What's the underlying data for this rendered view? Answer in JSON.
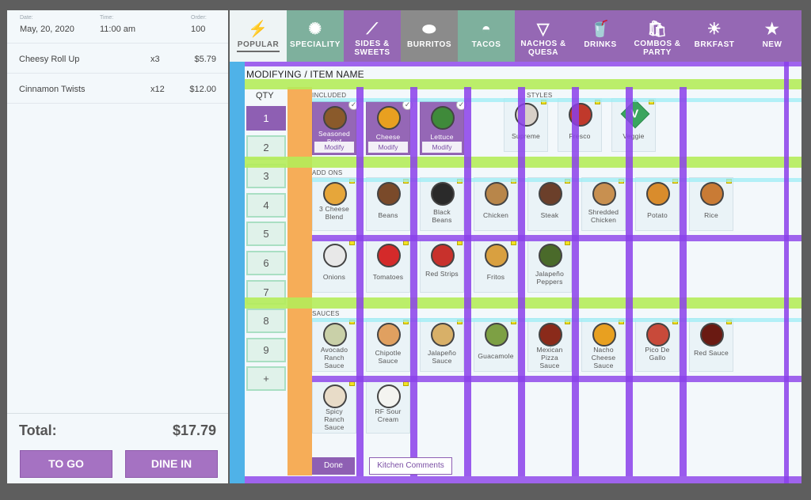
{
  "order": {
    "date_label": "Date:",
    "date_value": "May, 20, 2020",
    "time_label": "Time:",
    "time_value": "11:00 am",
    "order_label": "Order:",
    "order_value": "100",
    "items": [
      {
        "name": "Cheesy Roll Up",
        "qty": "x3",
        "price": "$5.79"
      },
      {
        "name": "Cinnamon Twists",
        "qty": "x12",
        "price": "$12.00"
      }
    ],
    "total_label": "Total:",
    "total_value": "$17.79",
    "to_go_label": "TO GO",
    "dine_in_label": "DINE IN"
  },
  "categories": [
    {
      "label": "POPULAR",
      "icon": "lightning-icon",
      "glyph": "⚡"
    },
    {
      "label": "SPECIALITY",
      "icon": "star-badge-icon",
      "glyph": "✺"
    },
    {
      "label": "SIDES & SWEETS",
      "icon": "churro-icon",
      "glyph": "⟋"
    },
    {
      "label": "BURRITOS",
      "icon": "burrito-icon",
      "glyph": "⬬"
    },
    {
      "label": "TACOS",
      "icon": "taco-icon",
      "glyph": "◓"
    },
    {
      "label": "NACHOS & QUESA",
      "icon": "nachos-icon",
      "glyph": "▽"
    },
    {
      "label": "DRINKS",
      "icon": "drink-cup-icon",
      "glyph": "🥤"
    },
    {
      "label": "COMBOS & PARTY",
      "icon": "combo-bag-icon",
      "glyph": "🛍"
    },
    {
      "label": "BRKFAST",
      "icon": "sunrise-icon",
      "glyph": "☀"
    },
    {
      "label": "NEW",
      "icon": "star-icon",
      "glyph": "★"
    }
  ],
  "colors": {
    "tab_popular": "#eef4f5",
    "tab_speciality": "#7eb09d",
    "tab_sides": "#9568b4",
    "tab_burritos": "#8b8b8b",
    "tab_tacos": "#7eb09d",
    "tab_nachos": "#9568b4",
    "tab_drinks": "#9568b4",
    "tab_combos": "#9568b4",
    "tab_brkfast": "#9568b4",
    "tab_new": "#9568b4"
  },
  "modifier": {
    "title": "MODIFYING / ITEM NAME",
    "qty_label": "QTY",
    "qty_options": [
      "1",
      "2",
      "3",
      "4",
      "5",
      "6",
      "7",
      "8",
      "9",
      "+"
    ],
    "selected_qty": "1",
    "included_title": "INCLUDED",
    "included": [
      {
        "name": "Seasoned Beef",
        "modify": "Modify",
        "color": "#8a5a2b"
      },
      {
        "name": "Cheese",
        "modify": "Modify",
        "color": "#e8a020"
      },
      {
        "name": "Lettuce",
        "modify": "Modify",
        "color": "#3f8a3a"
      }
    ],
    "styles_title": "STYLES",
    "styles": [
      {
        "name": "Supreme",
        "color": "#d8d0c8"
      },
      {
        "name": "Fresco",
        "color": "#c0392b"
      },
      {
        "name": "Veggie",
        "badge": "V"
      }
    ],
    "addons_title": "ADD ONS",
    "addons": [
      {
        "name": "3 Cheese Blend",
        "color": "#e6a63a"
      },
      {
        "name": "Beans",
        "color": "#7a4a2a"
      },
      {
        "name": "Black Beans",
        "color": "#2a2a2a"
      },
      {
        "name": "Chicken",
        "color": "#b8864a"
      },
      {
        "name": "Steak",
        "color": "#6b3f2a"
      },
      {
        "name": "Shredded Chicken",
        "color": "#c89050"
      },
      {
        "name": "Potato",
        "color": "#d98c2c"
      },
      {
        "name": "Rice",
        "color": "#c97b35"
      },
      {
        "name": "Onions",
        "color": "#e8e8e8"
      },
      {
        "name": "Tomatoes",
        "color": "#d42a2a"
      },
      {
        "name": "Red Strips",
        "color": "#c8312c"
      },
      {
        "name": "Fritos",
        "color": "#d9a040"
      },
      {
        "name": "Jalapeño Peppers",
        "color": "#4a6a2a"
      }
    ],
    "sauces_title": "SAUCES",
    "sauces": [
      {
        "name": "Avocado Ranch Sauce",
        "color": "#c9d0a8"
      },
      {
        "name": "Chipotle Sauce",
        "color": "#e0a060"
      },
      {
        "name": "Jalapeño Sauce",
        "color": "#d8b068"
      },
      {
        "name": "Guacamole",
        "color": "#7da044"
      },
      {
        "name": "Mexican Pizza Sauce",
        "color": "#8a2a1a"
      },
      {
        "name": "Nacho Cheese Sauce",
        "color": "#e8a020"
      },
      {
        "name": "Pico De Gallo",
        "color": "#c84a3a"
      },
      {
        "name": "Red Sauce",
        "color": "#6a1a12"
      },
      {
        "name": "Spicy Ranch Sauce",
        "color": "#e8dcc8"
      },
      {
        "name": "RF Sour Cream",
        "color": "#f4f4f0"
      }
    ],
    "done_label": "Done",
    "kitchen_label": "Kitchen Comments"
  }
}
